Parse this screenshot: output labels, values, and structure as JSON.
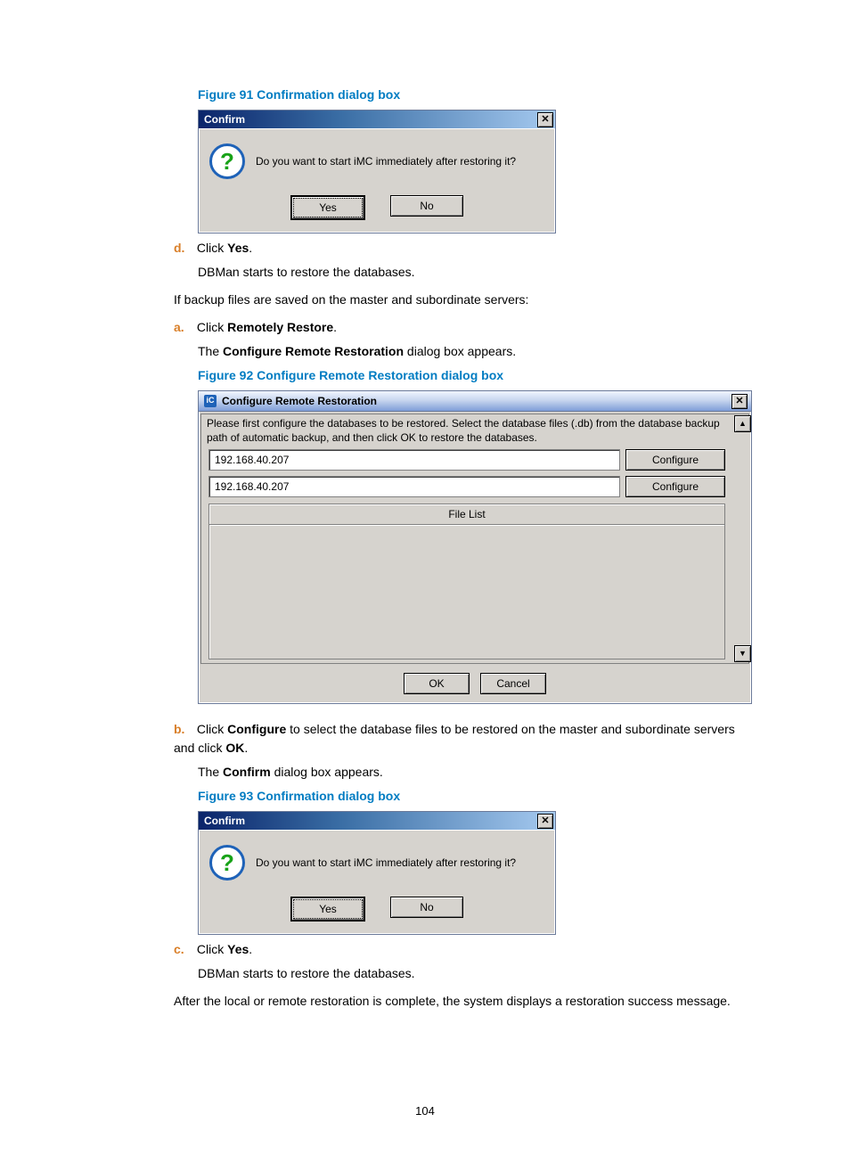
{
  "pageNumber": "104",
  "fig91": {
    "caption": "Figure 91 Confirmation dialog box",
    "title": "Confirm",
    "message": "Do you want to start iMC immediately after restoring it?",
    "yes": "Yes",
    "no": "No"
  },
  "step_d": {
    "letter": "d.",
    "text_pre": "Click ",
    "bold": "Yes",
    "text_post": "."
  },
  "step_d_sub": "DBMan starts to restore the databases.",
  "line_if": "If backup files are saved on the master and subordinate servers:",
  "step_a": {
    "letter": "a.",
    "text_pre": "Click ",
    "bold": "Remotely Restore",
    "text_post": "."
  },
  "step_a_sub_pre": "The ",
  "step_a_sub_bold": "Configure Remote Restoration",
  "step_a_sub_post": " dialog box appears.",
  "fig92": {
    "caption": "Figure 92 Configure Remote Restoration dialog box",
    "title": "Configure Remote Restoration",
    "instruction": "Please first configure the databases to be restored. Select the database files (.db) from the database backup path of automatic backup, and then click OK to restore the databases.",
    "rows": [
      {
        "ip": "192.168.40.207",
        "btn": "Configure"
      },
      {
        "ip": "192.168.40.207",
        "btn": "Configure"
      }
    ],
    "fileListHeader": "File List",
    "ok": "OK",
    "cancel": "Cancel"
  },
  "step_b": {
    "letter": "b.",
    "pre": "Click ",
    "bold1": "Configure",
    "mid": " to select the database files to be restored on the master and subordinate servers and click ",
    "bold2": "OK",
    "post": "."
  },
  "step_b_sub_pre": "The ",
  "step_b_sub_bold": "Confirm",
  "step_b_sub_post": " dialog box appears.",
  "fig93": {
    "caption": "Figure 93 Confirmation dialog box",
    "title": "Confirm",
    "message": "Do you want to start iMC immediately after restoring it?",
    "yes": "Yes",
    "no": "No"
  },
  "step_c": {
    "letter": "c.",
    "text_pre": "Click ",
    "bold": "Yes",
    "text_post": "."
  },
  "step_c_sub": "DBMan starts to restore the databases.",
  "line_after": "After the local or remote restoration is complete, the system displays a restoration success message."
}
